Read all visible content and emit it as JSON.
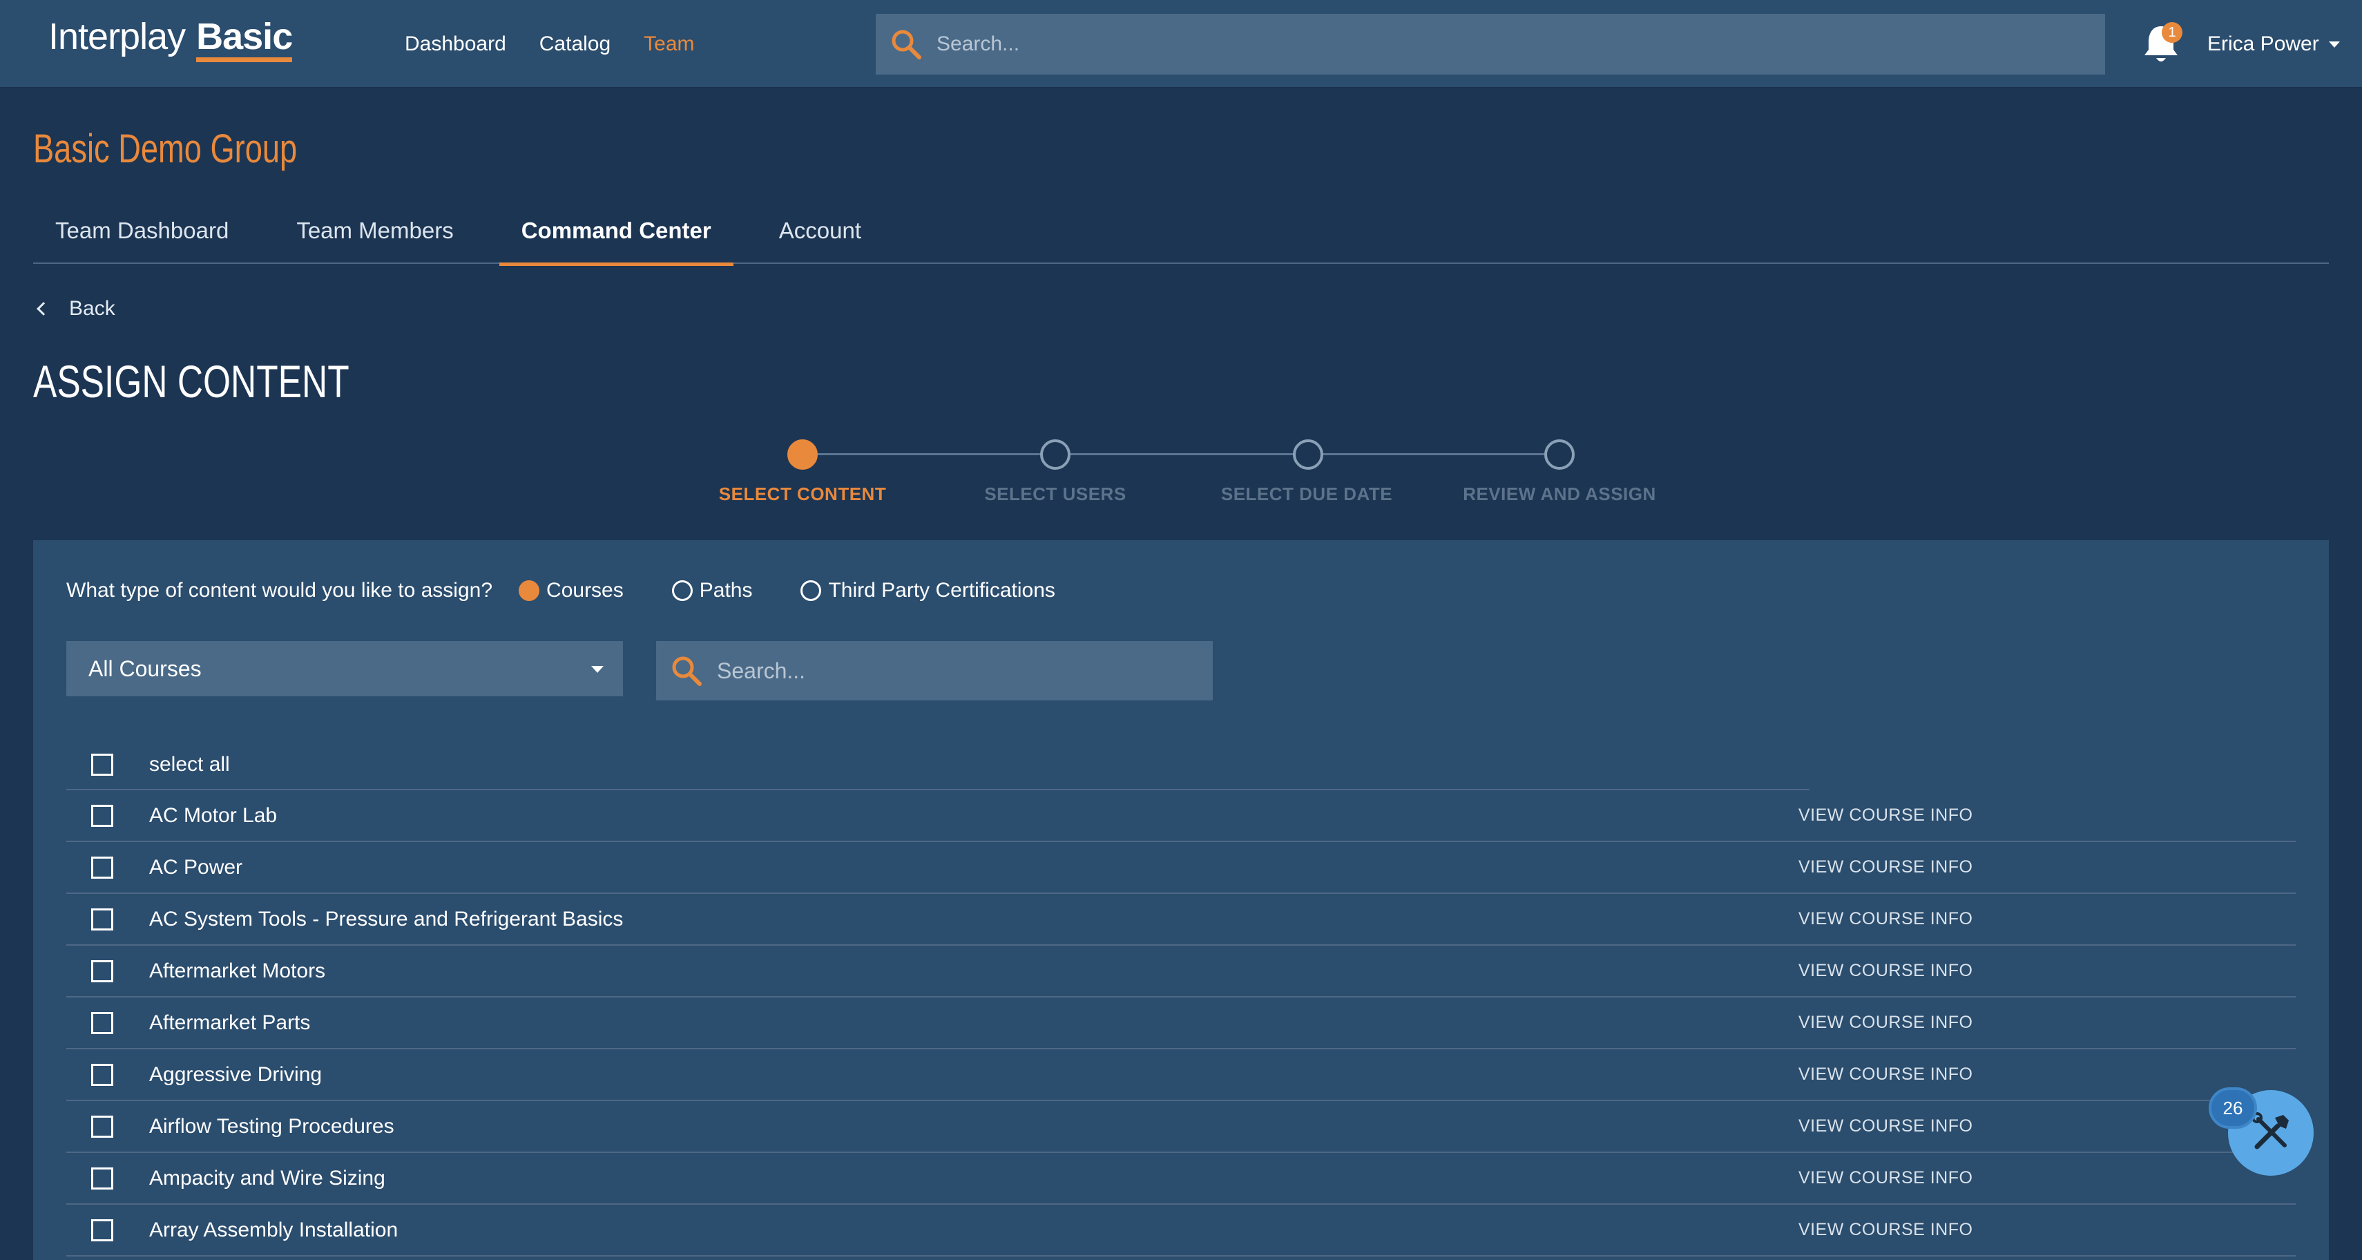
{
  "header": {
    "logo_light": "Interplay",
    "logo_bold": "Basic",
    "nav": [
      "Dashboard",
      "Catalog",
      "Team"
    ],
    "active_nav": "Team",
    "search_placeholder": "Search...",
    "notification_count": "1",
    "user_name": "Erica Power"
  },
  "group": {
    "title": "Basic Demo Group",
    "tabs": [
      "Team Dashboard",
      "Team Members",
      "Command Center",
      "Account"
    ],
    "active_tab": "Command Center"
  },
  "back_label": "Back",
  "page_title": "ASSIGN CONTENT",
  "stepper": {
    "steps": [
      "SELECT CONTENT",
      "SELECT USERS",
      "SELECT DUE DATE",
      "REVIEW AND ASSIGN"
    ],
    "current_step": 1
  },
  "panel": {
    "question": "What type of content would you like to assign?",
    "options": [
      "Courses",
      "Paths",
      "Third Party Certifications"
    ],
    "selected_option": "Courses",
    "filter_selected": "All Courses",
    "search_placeholder": "Search...",
    "select_all_label": "select all",
    "view_info_label": "VIEW COURSE INFO",
    "courses": [
      "AC Motor Lab",
      "AC Power",
      "AC System Tools - Pressure and Refrigerant Basics",
      "Aftermarket Motors",
      "Aftermarket Parts",
      "Aggressive Driving",
      "Airflow Testing Procedures",
      "Ampacity and Wire Sizing",
      "Array Assembly Installation"
    ]
  },
  "help_badge_count": "26",
  "colors": {
    "accent": "#e9893c",
    "page_bg": "#1c3553",
    "panel_bg": "#2b4d6e",
    "input_bg": "#4a6a88",
    "help_button": "#5aa9e6"
  }
}
